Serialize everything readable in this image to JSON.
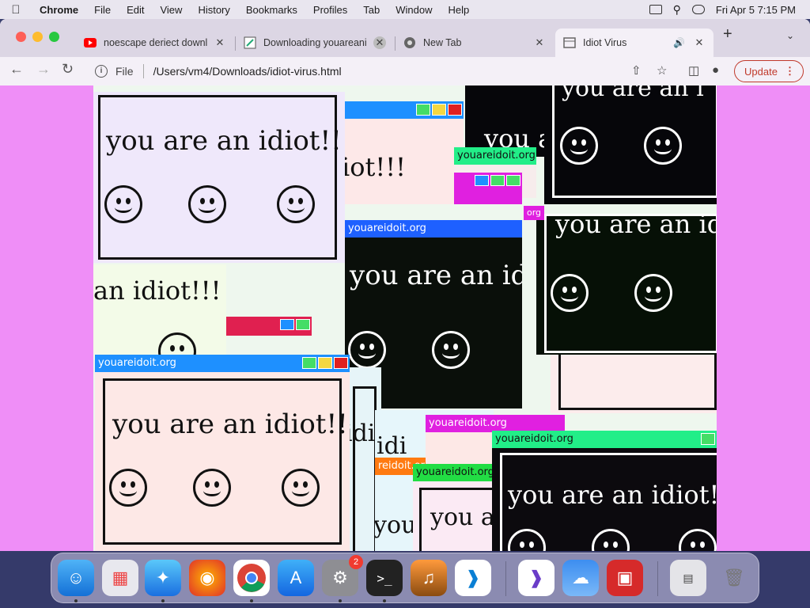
{
  "menubar": {
    "app_name": "Chrome",
    "items": [
      "File",
      "Edit",
      "View",
      "History",
      "Bookmarks",
      "Profiles",
      "Tab",
      "Window",
      "Help"
    ],
    "clock": "Fri Apr 5  7:15 PM"
  },
  "tabs": [
    {
      "title": "noescape deriect downl",
      "favicon": "youtube-icon"
    },
    {
      "title": "Downloading youareani",
      "favicon": "download-page-icon"
    },
    {
      "title": "New Tab",
      "favicon": "chrome-icon"
    },
    {
      "title": "Idiot Virus",
      "favicon": "page-icon",
      "audio": "speaker-icon"
    }
  ],
  "toolbar": {
    "scheme": "File",
    "url": "/Users/vm4/Downloads/idiot-virus.html",
    "update_label": "Update"
  },
  "popup": {
    "site": "youareidoit.org",
    "site_short": "reidoit.org",
    "site_cut": "org",
    "message": "you are an idiot!!!",
    "frag_a": "an idiot!!!",
    "frag_b": "you a",
    "frag_c": "you are an idi",
    "frag_d": "you are an id",
    "frag_e": "idiot!!!",
    "frag_f": "you are an idiot!",
    "frag_g": "you",
    "frag_h": "idi",
    "frag_i": "you are an i",
    "frag_j": "iot!!!"
  },
  "dock": {
    "apps": [
      "Finder",
      "Launchpad",
      "Safari",
      "Firefox",
      "Chrome",
      "App Store",
      "System Settings",
      "Terminal",
      "GarageBand",
      "VS Code",
      "Visual Studio",
      "Weather",
      "Photo Booth",
      "Preview",
      "Trash"
    ],
    "settings_badge": "2"
  },
  "colors": {
    "page_background": "#ef8ef7",
    "titlebar_blue": "#1e90ff",
    "titlebar_magenta": "#e020e0",
    "titlebar_green": "#22ee88",
    "titlebar_orange": "#ff7a10"
  }
}
